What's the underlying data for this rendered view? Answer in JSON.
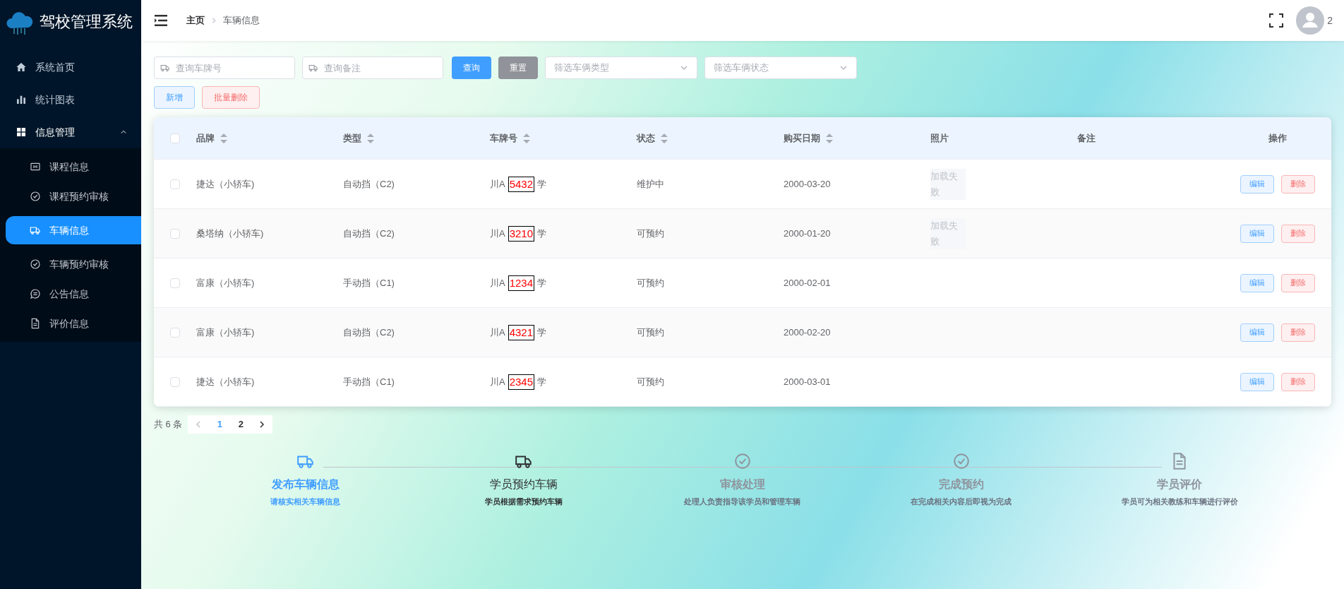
{
  "sidebar": {
    "title": "驾校管理系统",
    "items": [
      {
        "label": "系统首页"
      },
      {
        "label": "统计图表"
      },
      {
        "label": "信息管理",
        "expanded": true,
        "children": [
          {
            "label": "课程信息",
            "selected": false
          },
          {
            "label": "课程预约审核",
            "selected": false
          },
          {
            "label": "车辆信息",
            "selected": true
          },
          {
            "label": "车辆预约审核",
            "selected": false
          },
          {
            "label": "公告信息",
            "selected": false
          },
          {
            "label": "评价信息",
            "selected": false
          }
        ]
      }
    ]
  },
  "header": {
    "breadcrumb": [
      "主页",
      "车辆信息"
    ],
    "user": "2"
  },
  "filters": {
    "plate_placeholder": "查询车牌号",
    "note_placeholder": "查询备注",
    "search_button": "查询",
    "reset_button": "重置",
    "type_placeholder": "筛选车俩类型",
    "status_placeholder": "筛选车俩状态"
  },
  "actions": {
    "add": "新增",
    "batch_delete": "批量删除"
  },
  "table": {
    "all_checked": false,
    "columns": [
      {
        "label": "品牌",
        "sortable": true
      },
      {
        "label": "类型",
        "sortable": true
      },
      {
        "label": "车牌号",
        "sortable": true
      },
      {
        "label": "状态",
        "sortable": true
      },
      {
        "label": "购买日期",
        "sortable": true
      },
      {
        "label": "照片",
        "sortable": false
      },
      {
        "label": "备注",
        "sortable": false
      },
      {
        "label": "操作",
        "sortable": false
      }
    ],
    "rows": [
      {
        "checked": false,
        "brand": "捷达（小轿车)",
        "type": "自动挡（C2)",
        "plate_prefix": "川A",
        "plate_number": "5432",
        "plate_suffix": "学",
        "status": "维护中",
        "date": "2000-03-20",
        "photo": "加载失败",
        "edit": "编辑",
        "delete": "删除"
      },
      {
        "checked": false,
        "brand": "桑塔纳（小轿车)",
        "type": "自动挡（C2)",
        "plate_prefix": "川A",
        "plate_number": "3210",
        "plate_suffix": "学",
        "status": "可预约",
        "date": "2000-01-20",
        "photo": "加载失败",
        "edit": "编辑",
        "delete": "删除"
      },
      {
        "checked": false,
        "brand": "富康（小轿车)",
        "type": "手动挡（C1)",
        "plate_prefix": "川A",
        "plate_number": "1234",
        "plate_suffix": "学",
        "status": "可预约",
        "date": "2000-02-01",
        "edit": "编辑",
        "delete": "删除"
      },
      {
        "checked": false,
        "brand": "富康（小轿车)",
        "type": "自动挡（C2)",
        "plate_prefix": "川A",
        "plate_number": "4321",
        "plate_suffix": "学",
        "status": "可预约",
        "date": "2000-02-20",
        "edit": "编辑",
        "delete": "删除"
      },
      {
        "checked": false,
        "brand": "捷达（小轿车)",
        "type": "手动挡（C1)",
        "plate_prefix": "川A",
        "plate_number": "2345",
        "plate_suffix": "学",
        "status": "可预约",
        "date": "2000-03-01",
        "edit": "编辑",
        "delete": "删除"
      }
    ]
  },
  "pagination": {
    "total": "共 6 条",
    "pages": [
      {
        "label": "1",
        "selected": true
      },
      {
        "label": "2",
        "selected": false
      }
    ]
  },
  "steps": [
    {
      "title": "发布车辆信息",
      "description": "请核实相关车辆信息",
      "completed": true,
      "active": false
    },
    {
      "title": "学员预约车辆",
      "description": "学员根据需求预约车辆",
      "completed": false,
      "active": true
    },
    {
      "title": "审核处理",
      "description": "处理人负责指导该学员和管理车辆",
      "completed": false,
      "active": false
    },
    {
      "title": "完成预约",
      "description": "在完成相关内容后即视为完成",
      "completed": false,
      "active": false
    },
    {
      "title": "学员评价",
      "description": "学员可为相关教练和车辆进行评价",
      "completed": false,
      "active": false
    }
  ]
}
